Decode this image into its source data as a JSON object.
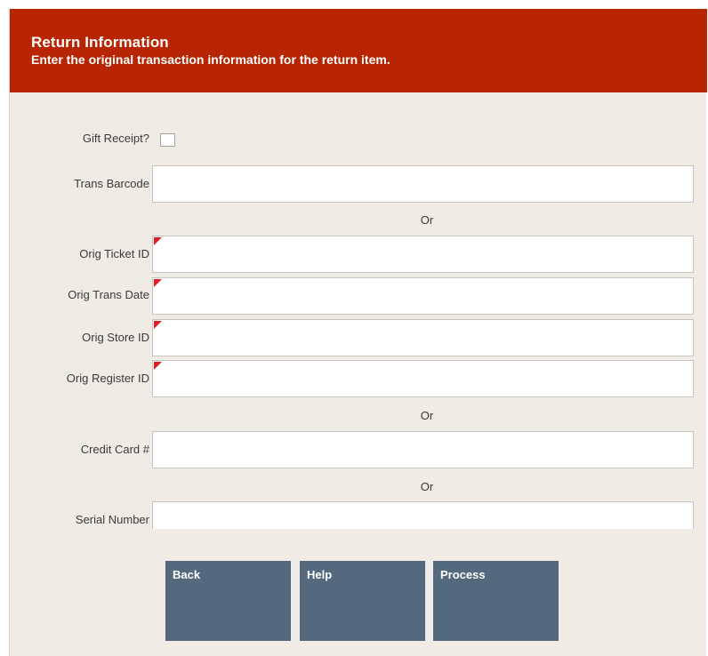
{
  "header": {
    "title": "Return Information",
    "subtitle": "Enter the original transaction information for the return item."
  },
  "form": {
    "gift_receipt_label": "Gift Receipt?",
    "gift_receipt_checked": false,
    "trans_barcode_label": "Trans Barcode",
    "trans_barcode_value": "",
    "or_1": "Or",
    "orig_ticket_id_label": "Orig Ticket ID",
    "orig_ticket_id_value": "",
    "orig_trans_date_label": "Orig Trans Date",
    "orig_trans_date_value": "",
    "orig_store_id_label": "Orig Store ID",
    "orig_store_id_value": "",
    "orig_register_id_label": "Orig Register ID",
    "orig_register_id_value": "",
    "or_2": "Or",
    "credit_card_label": "Credit Card #",
    "credit_card_value": "",
    "or_3": "Or",
    "serial_number_label": "Serial Number",
    "serial_number_value": ""
  },
  "buttons": {
    "back": "Back",
    "help": "Help",
    "process": "Process"
  },
  "colors": {
    "header_bg": "#b82503",
    "panel_bg": "#f1ebe6",
    "button_bg": "#54697d",
    "required_marker": "#e02020"
  }
}
